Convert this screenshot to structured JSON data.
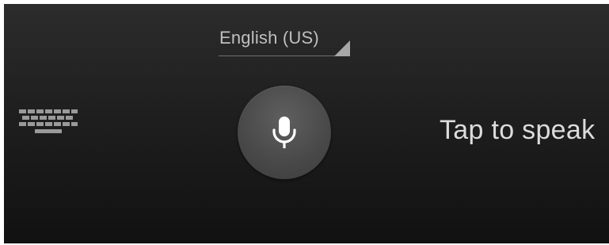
{
  "language_selector": {
    "label": "English (US)"
  },
  "prompt": {
    "text": "Tap to speak"
  },
  "icons": {
    "keyboard": "keyboard-icon",
    "microphone": "microphone-icon"
  },
  "colors": {
    "background_top": "#2c2c2c",
    "background_bottom": "#111111",
    "mic_button": "#4a4a4a",
    "text": "#dcdcdc"
  }
}
